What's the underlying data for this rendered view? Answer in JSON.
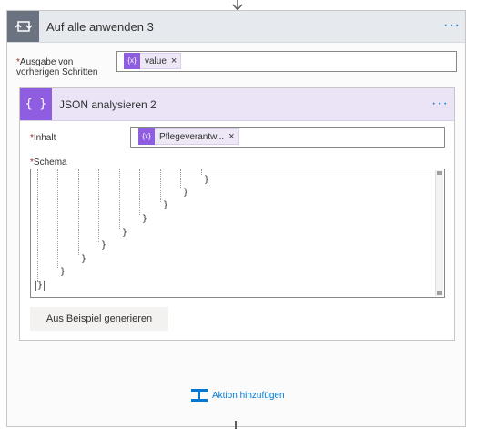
{
  "loop": {
    "title": "Auf alle anwenden 3",
    "more_label": "···",
    "field_label": "Ausgabe von vorherigen Schritten",
    "required_mark": "*",
    "token_label": "value",
    "token_remove": "×"
  },
  "json_action": {
    "title": "JSON analysieren 2",
    "more_label": "···",
    "content_label": "Inhalt",
    "content_token_label": "Pflegeverantw...",
    "content_token_remove": "×",
    "schema_label": "Schema",
    "schema_closing_braces": [
      "}",
      "}",
      "}",
      "}",
      "}",
      "}",
      "}",
      "}",
      "}"
    ],
    "generate_button": "Aus Beispiel generieren"
  },
  "footer": {
    "add_action_label": "Aktion hinzufügen"
  },
  "colors": {
    "accent_blue": "#0078d4",
    "loop_icon_bg": "#6b7280",
    "json_icon_bg": "#8e5de0",
    "json_header_bg": "#ebe4f7"
  }
}
